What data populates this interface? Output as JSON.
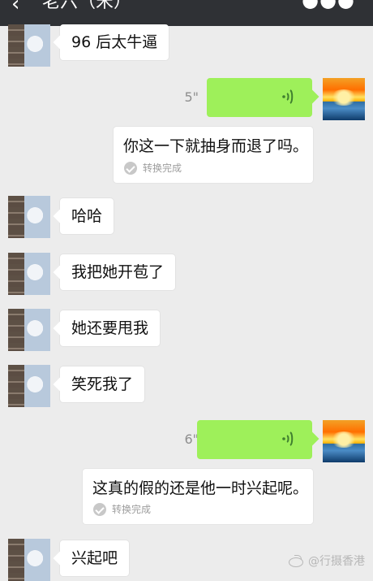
{
  "header": {
    "back_icon": "back-arrow-icon",
    "title": "老六（宋）",
    "more_icon": "more-icon"
  },
  "messages": [
    {
      "type": "text",
      "side": "left",
      "text": "96 后太牛逼"
    },
    {
      "type": "voice",
      "side": "right",
      "duration": "5\""
    },
    {
      "type": "transcript",
      "side": "right",
      "text": "你这一下就抽身而退了吗。",
      "status": "转换完成"
    },
    {
      "type": "text",
      "side": "left",
      "text": "哈哈"
    },
    {
      "type": "text",
      "side": "left",
      "text": "我把她开苞了"
    },
    {
      "type": "text",
      "side": "left",
      "text": "她还要甩我"
    },
    {
      "type": "text",
      "side": "left",
      "text": "笑死我了"
    },
    {
      "type": "voice",
      "side": "right",
      "duration": "6\""
    },
    {
      "type": "transcript",
      "side": "right",
      "text": "这真的假的还是他一时兴起呢。",
      "status": "转换完成"
    },
    {
      "type": "text",
      "side": "left",
      "text": "兴起吧"
    }
  ],
  "watermark": {
    "text": "@行摄香港",
    "icon": "weibo-icon"
  },
  "colors": {
    "topbar": "#2f3135",
    "chat_bg": "#ececec",
    "sent_voice": "#9ef05a",
    "received_bubble": "#ffffff"
  }
}
